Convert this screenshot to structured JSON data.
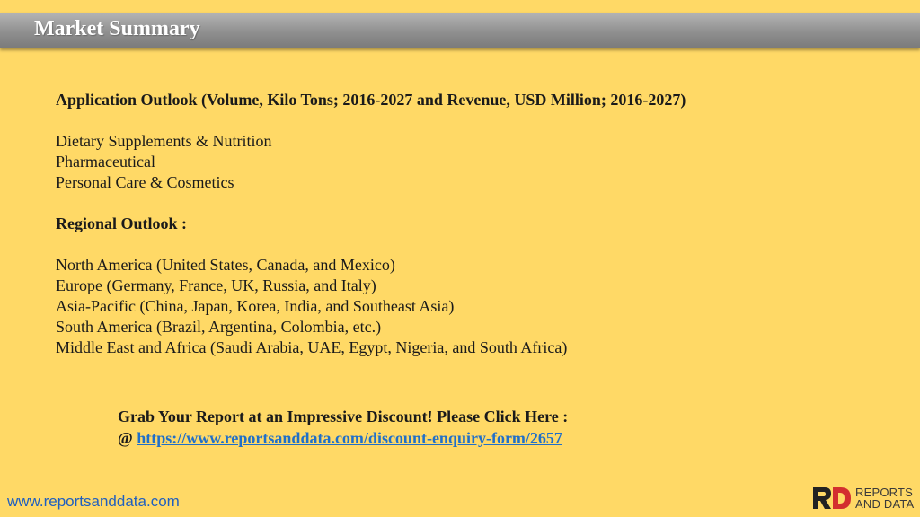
{
  "header": {
    "title": "Market Summary"
  },
  "application": {
    "heading": "Application Outlook (Volume, Kilo Tons; 2016-2027 and Revenue, USD Million; 2016-2027)",
    "items": [
      "Dietary Supplements & Nutrition",
      "Pharmaceutical",
      "Personal Care & Cosmetics"
    ]
  },
  "regional": {
    "heading": "Regional Outlook :",
    "items": [
      "North America (United States, Canada, and Mexico)",
      "Europe (Germany, France, UK, Russia, and Italy)",
      "Asia-Pacific (China, Japan, Korea, India, and Southeast Asia)",
      "South America (Brazil, Argentina, Colombia, etc.)",
      "Middle East and Africa (Saudi Arabia, UAE, Egypt, Nigeria, and South Africa)"
    ]
  },
  "cta": {
    "text": "Grab Your Report at an Impressive Discount! Please Click Here :",
    "prefix": "@ ",
    "link": "https://www.reportsanddata.com/discount-enquiry-form/2657"
  },
  "footer": {
    "url": "www.reportsanddata.com",
    "logo_line1": "REPORTS",
    "logo_line2": "AND DATA"
  },
  "colors": {
    "background": "#ffd966",
    "title_bar": "#8f8f8f",
    "link": "#1f6fc9",
    "logo_red": "#d32f2f"
  }
}
